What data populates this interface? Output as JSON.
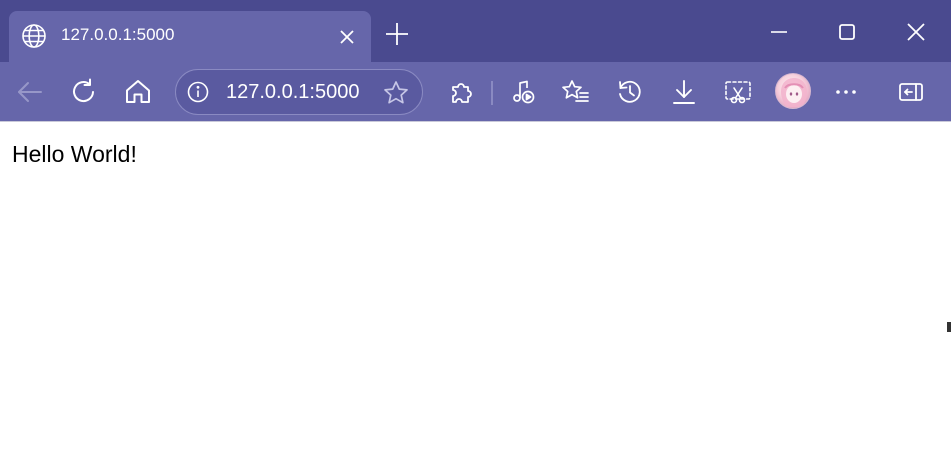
{
  "tab": {
    "title": "127.0.0.1:5000",
    "favicon": "globe-icon",
    "close_icon": "close-icon"
  },
  "new_tab_icon": "plus-icon",
  "window_controls": [
    "minimize-icon",
    "maximize-icon",
    "close-icon"
  ],
  "toolbar": {
    "icons": [
      "back-arrow-icon",
      "refresh-icon",
      "home-icon",
      "extensions-icon",
      "media-control-icon",
      "favorites-list-icon",
      "history-icon",
      "download-icon",
      "screenshot-icon",
      "profile-avatar",
      "more-menu-icon",
      "sidebar-icon"
    ],
    "back_enabled": false
  },
  "address_bar": {
    "url": "127.0.0.1:5000",
    "site_info_icon": "info-icon",
    "favorite_icon": "star-icon"
  },
  "page": {
    "text": "Hello World!"
  },
  "colors": {
    "titlebar": "#4a4a8f",
    "toolbar": "#6666aa",
    "content": "#ffffff"
  }
}
